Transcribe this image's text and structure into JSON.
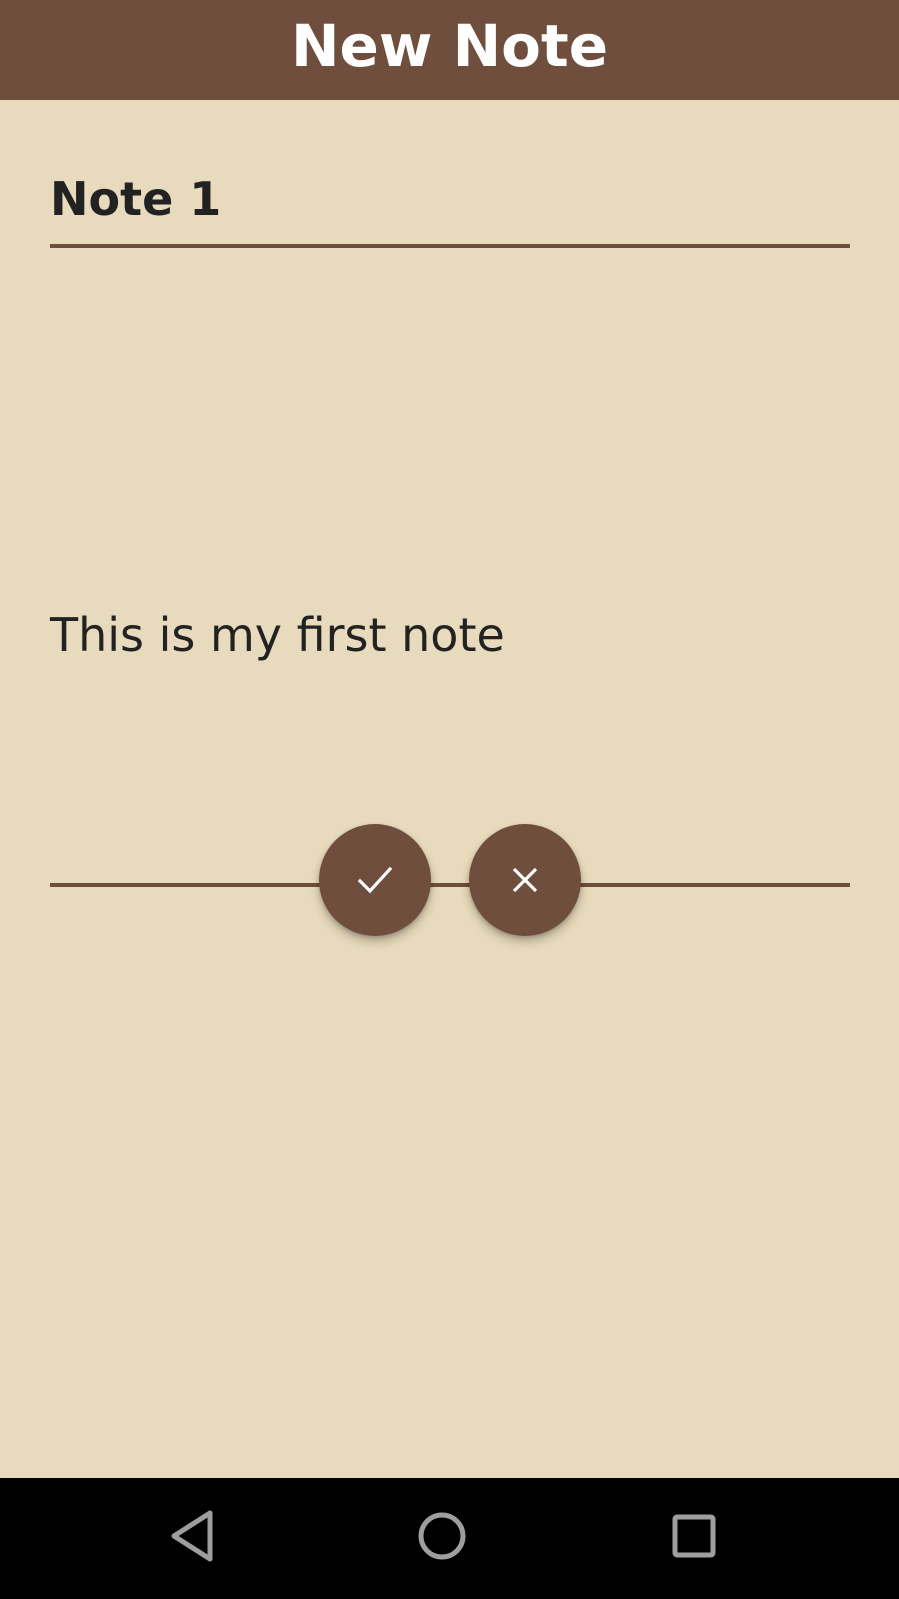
{
  "app_bar": {
    "title": "New Note",
    "background": "#6F4E3E",
    "title_color": "#FFFFFF"
  },
  "note": {
    "title_value": "Note 1",
    "body_value": "This is my first note"
  },
  "actions": {
    "confirm_icon": "check-icon",
    "cancel_icon": "close-icon",
    "button_color": "#6F4E3E"
  },
  "navigation_bar": {
    "back_icon": "back-triangle-icon",
    "home_icon": "home-circle-icon",
    "recents_icon": "recents-square-icon"
  },
  "colors": {
    "background": "#E8DABC",
    "accent": "#6F4E3E",
    "text": "#222222"
  }
}
